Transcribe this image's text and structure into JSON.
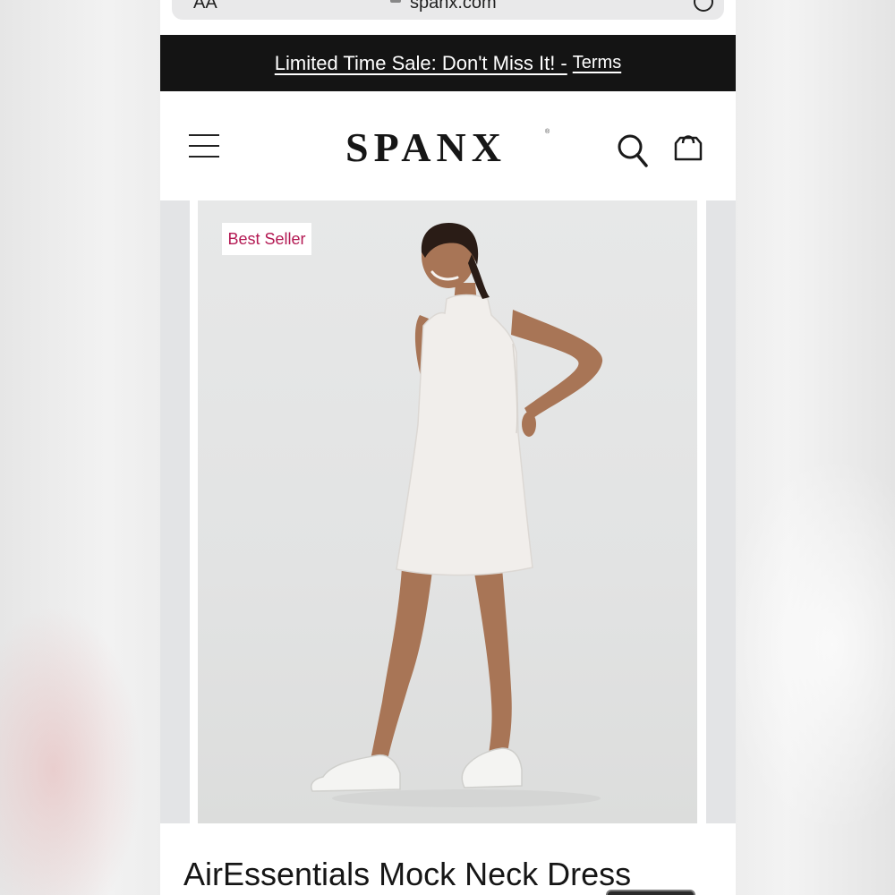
{
  "browser": {
    "text_size_label": "AA",
    "domain": "spanx.com"
  },
  "promo": {
    "message": "Limited Time Sale: Don't Miss It! -",
    "terms_label": "Terms",
    "background": "#141414"
  },
  "header": {
    "logo": "SPANX",
    "logo_mark": "®",
    "icons": [
      "hamburger-menu-icon",
      "search-icon",
      "shopping-bag-icon"
    ]
  },
  "gallery": {
    "badge": "Best Seller",
    "badge_color": "#b31852"
  },
  "product": {
    "title": "AirEssentials Mock Neck Dress"
  }
}
